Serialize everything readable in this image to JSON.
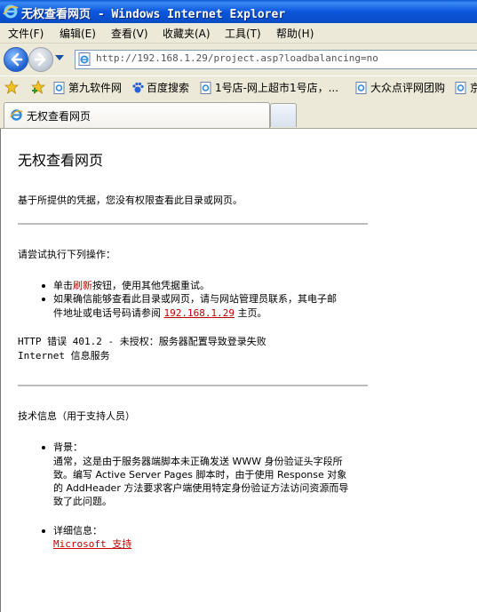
{
  "window": {
    "title": "无权查看网页 - Windows Internet Explorer"
  },
  "menu": [
    "文件(F)",
    "编辑(E)",
    "查看(V)",
    "收藏夹(A)",
    "工具(T)",
    "帮助(H)"
  ],
  "address": {
    "url": "http://192.168.1.29/project.asp?loadbalancing=no"
  },
  "favorites": [
    "第九软件网",
    "百度搜索",
    "1号店-网上超市1号店，...",
    "大众点评网团购",
    "京"
  ],
  "tab": {
    "label": "无权查看网页"
  },
  "page": {
    "heading": "无权查看网页",
    "intro": "基于所提供的凭据，您没有权限查看此目录或网页。",
    "try_heading": "请尝试执行下列操作：",
    "b1_pre": "单击",
    "b1_link": "刷新",
    "b1_post": "按钮，使用其他凭据重试。",
    "b2_line1": "如果确信能够查看此目录或网页，请与网站管理员联系，其电子邮",
    "b2_pre": "件地址或电话号码请参阅 ",
    "b2_link": "192.168.1.29",
    "b2_post": " 主页。",
    "error_line1": "HTTP 错误 401.2 - 未授权：服务器配置导致登录失败",
    "error_line2": "Internet 信息服务",
    "tech_heading": "技术信息（用于支持人员）",
    "bg_label": "背景：",
    "bg_line1": "通常，这是由于服务器端脚本未正确发送 WWW 身份验证头字段所",
    "bg_line2": "致。编写 Active Server Pages 脚本时，由于使用 Response 对象",
    "bg_line3": "的 AddHeader 方法要求客户端使用特定身份验证方法访问资源而导",
    "bg_line4": "致了此问题。",
    "detail_label": "详细信息：",
    "detail_link": "Microsoft 支持"
  }
}
